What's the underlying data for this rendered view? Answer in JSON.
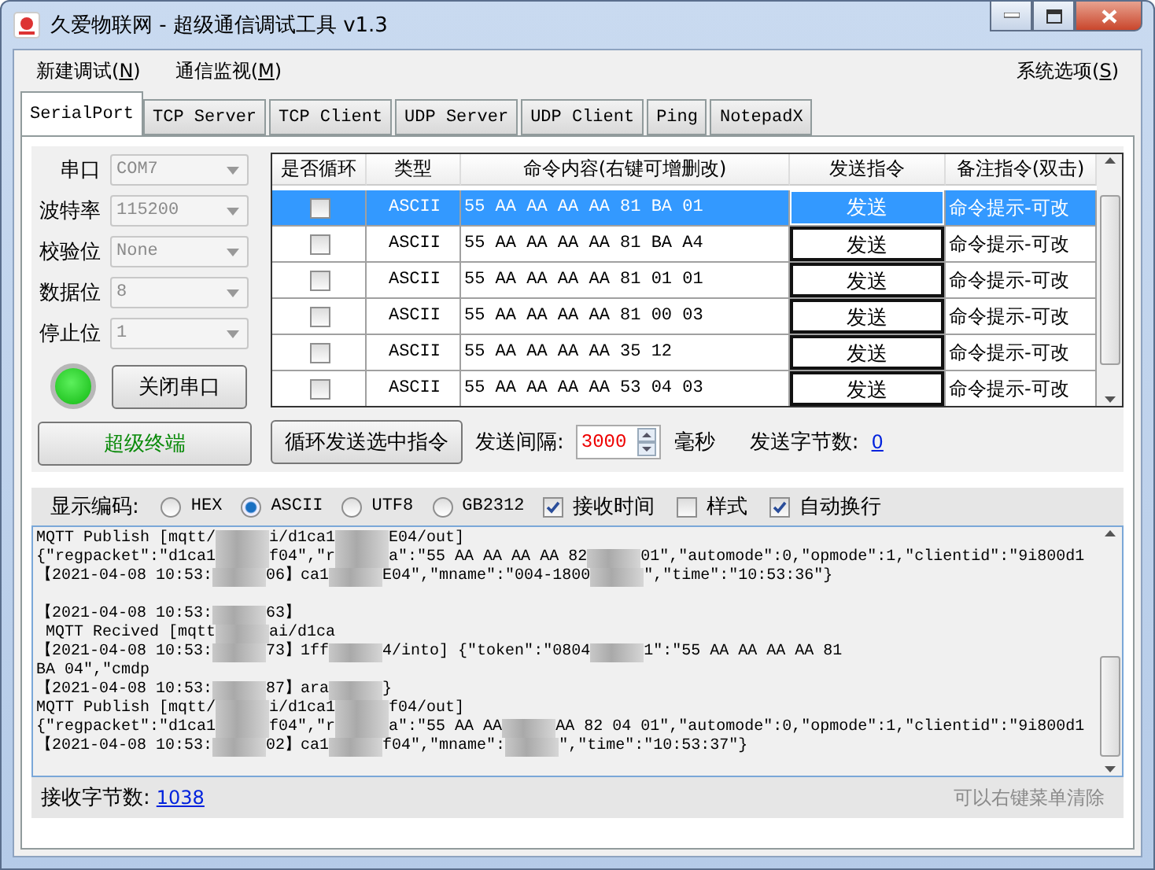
{
  "window": {
    "title": "久爱物联网 - 超级通信调试工具 v1.3"
  },
  "menu_left": [
    {
      "before": "新建调试(",
      "key": "N",
      "after": ")"
    },
    {
      "before": "通信监视(",
      "key": "M",
      "after": ")"
    }
  ],
  "menu_right": [
    {
      "before": "系统选项(",
      "key": "S",
      "after": ")"
    }
  ],
  "tabs": [
    {
      "label": "SerialPort",
      "selected": true
    },
    {
      "label": "TCP Server",
      "selected": false
    },
    {
      "label": "TCP Client",
      "selected": false
    },
    {
      "label": "UDP Server",
      "selected": false
    },
    {
      "label": "UDP Client",
      "selected": false
    },
    {
      "label": "Ping",
      "selected": false
    },
    {
      "label": "NotepadX",
      "selected": false
    }
  ],
  "serial_settings": [
    {
      "label": "串口",
      "value": "COM7",
      "disabled": true
    },
    {
      "label": "波特率",
      "value": "115200",
      "disabled": true
    },
    {
      "label": "校验位",
      "value": "None",
      "disabled": true
    },
    {
      "label": "数据位",
      "value": "8",
      "disabled": true
    },
    {
      "label": "停止位",
      "value": "1",
      "disabled": true
    }
  ],
  "status_led": {
    "on": true
  },
  "close_port_button": "关闭串口",
  "super_terminal_button": "超级终端",
  "table": {
    "columns": [
      "是否循环",
      "类型",
      "命令内容(右键可增删改)",
      "发送指令",
      "备注指令(双击)"
    ],
    "rows": [
      {
        "selected": true,
        "loop": false,
        "type": "ASCII",
        "command": "55 AA AA AA AA 81 BA 01",
        "send": "发送",
        "remark": "命令提示-可改"
      },
      {
        "selected": false,
        "loop": false,
        "type": "ASCII",
        "command": "55 AA AA AA AA 81 BA A4",
        "send": "发送",
        "remark": "命令提示-可改"
      },
      {
        "selected": false,
        "loop": false,
        "type": "ASCII",
        "command": "55 AA AA AA AA 81 01 01",
        "send": "发送",
        "remark": "命令提示-可改"
      },
      {
        "selected": false,
        "loop": false,
        "type": "ASCII",
        "command": "55 AA AA AA AA 81 00 03",
        "send": "发送",
        "remark": "命令提示-可改"
      },
      {
        "selected": false,
        "loop": false,
        "type": "ASCII",
        "command": "55 AA AA AA AA 35 12",
        "send": "发送",
        "remark": "命令提示-可改"
      },
      {
        "selected": false,
        "loop": false,
        "type": "ASCII",
        "command": "55 AA AA AA AA 53 04 03",
        "send": "发送",
        "remark": "命令提示-可改"
      }
    ]
  },
  "loop_send_button": "循环发送选中指令",
  "interval": {
    "label": "发送间隔:",
    "value": "3000",
    "unit": "毫秒"
  },
  "sent_bytes": {
    "label": "发送字节数:",
    "value": "0"
  },
  "encoding": {
    "label": "显示编码:",
    "options": [
      {
        "label": "HEX",
        "selected": false
      },
      {
        "label": "ASCII",
        "selected": true
      },
      {
        "label": "UTF8",
        "selected": false
      },
      {
        "label": "GB2312",
        "selected": false
      }
    ],
    "checkboxes": [
      {
        "label": "接收时间",
        "checked": true
      },
      {
        "label": "样式",
        "checked": false
      },
      {
        "label": "自动换行",
        "checked": true
      }
    ]
  },
  "log": [
    {
      "kind": "text",
      "segments": [
        "MQTT Publish [mqtt/",
        "i/d1ca1",
        "E04/out]"
      ]
    },
    {
      "kind": "text",
      "segments": [
        "{\"regpacket\":\"d1ca1",
        "f04\",\"r",
        "a\":\"55 AA AA AA AA 82",
        "01\",\"automode\":0,\"opmode\":1,\"clientid\":\"9i800d1"
      ]
    },
    {
      "kind": "text",
      "segments": [
        "【2021-04-08 10:53:",
        "06】ca1",
        "E04\",\"mname\":\"004-1800",
        "\",\"time\":\"10:53:36\"}"
      ]
    },
    {
      "kind": "blank"
    },
    {
      "kind": "text",
      "segments": [
        "【2021-04-08 10:53:",
        "63】"
      ]
    },
    {
      "kind": "text",
      "segments": [
        " MQTT Recived [mqtt",
        "ai/d1ca"
      ]
    },
    {
      "kind": "text",
      "segments": [
        "【2021-04-08 10:53:",
        "73】1ff",
        "4/into] {\"token\":\"0804",
        "1\":\"55 AA AA AA AA 81"
      ]
    },
    {
      "kind": "text",
      "segments": [
        "BA 04\",\"cmdp"
      ]
    },
    {
      "kind": "text",
      "segments": [
        "【2021-04-08 10:53:",
        "87】ara",
        "}"
      ]
    },
    {
      "kind": "text",
      "segments": [
        "MQTT Publish [mqtt/",
        "i/d1ca1",
        "f04/out]"
      ]
    },
    {
      "kind": "text",
      "segments": [
        "{\"regpacket\":\"d1ca1",
        "f04\",\"r",
        "a\":\"55 AA AA",
        "AA 82 04 01\",\"automode\":0,\"opmode\":1,\"clientid\":\"9i800d1"
      ]
    },
    {
      "kind": "text",
      "segments": [
        "【2021-04-08 10:53:",
        "02】ca1",
        "f04\",\"mname\":",
        "\",\"time\":\"10:53:37\"}"
      ]
    }
  ],
  "status": {
    "received_label": "接收字节数:",
    "received": "1038",
    "hint": "可以右键菜单清除"
  }
}
